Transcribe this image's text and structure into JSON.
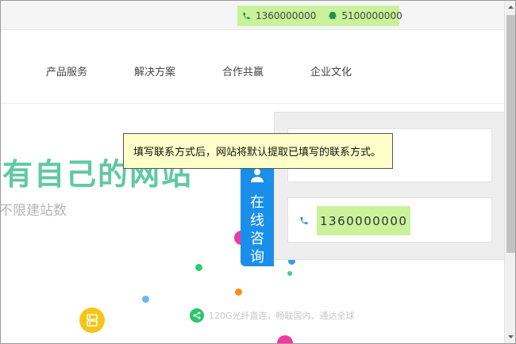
{
  "topbar": {
    "phone_icon": "phone-icon",
    "phone": "1360000000",
    "qq_icon": "qq-penguin-icon",
    "qq": "5100000000"
  },
  "nav": {
    "items": [
      {
        "label": "产品服务"
      },
      {
        "label": "解决方案"
      },
      {
        "label": "合作共赢"
      },
      {
        "label": "企业文化"
      }
    ]
  },
  "hero": {
    "title": "有自己的网站",
    "subtitle": "不限建站数",
    "feature": "120G光纤直连，畅联国内、通达全球"
  },
  "online_tab": {
    "label": "在线咨询",
    "icon": "user-icon",
    "color": "#1a8fe9"
  },
  "side_panel": {
    "phone_icon": "phone-icon",
    "phone": "1360000000"
  },
  "tooltip": {
    "text": "填写联系方式后，网站将默认提取已填写的联系方式。"
  },
  "colors": {
    "highlight": "#c9f29b",
    "accent_blue": "#1a8fe9",
    "hero_green": "#5fc9a2",
    "tooltip_bg": "#ffffc9"
  }
}
